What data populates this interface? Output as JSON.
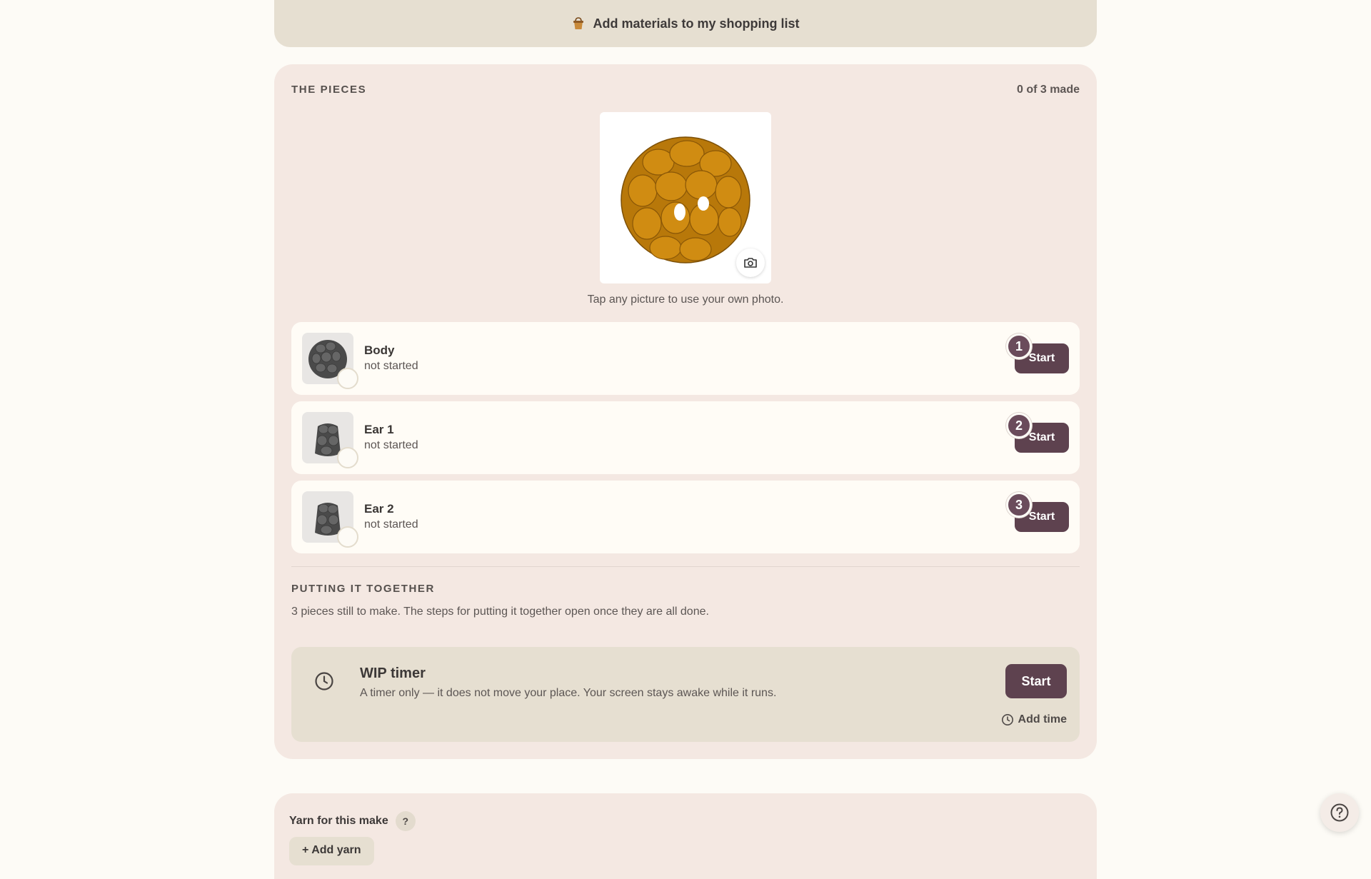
{
  "shopping": {
    "label": "Add materials to my shopping list",
    "icon": "basket-icon"
  },
  "pieces": {
    "title": "THE PIECES",
    "made_count": "0 of 3 made",
    "hint": "Tap any picture to use your own photo.",
    "items": [
      {
        "number": "1",
        "name": "Body",
        "status": "not started",
        "button": "Start"
      },
      {
        "number": "2",
        "name": "Ear 1",
        "status": "not started",
        "button": "Start"
      },
      {
        "number": "3",
        "name": "Ear 2",
        "status": "not started",
        "button": "Start"
      }
    ]
  },
  "together": {
    "title": "PUTTING IT TOGETHER",
    "text": "3 pieces still to make. The steps for putting it together open once they are all done."
  },
  "timer": {
    "title": "WIP timer",
    "description": "A timer only — it does not move your place. Your screen stays awake while it runs.",
    "start_label": "Start",
    "add_time_label": "Add time"
  },
  "yarn": {
    "title": "Yarn for this make",
    "help": "?",
    "add_label": "+ Add yarn"
  },
  "colors": {
    "page_bg": "#fdfbf6",
    "card_bg": "#f4e8e2",
    "panel_bg": "#e6dfd1",
    "accent": "#5e424f",
    "hero_model": "#b8780a"
  }
}
